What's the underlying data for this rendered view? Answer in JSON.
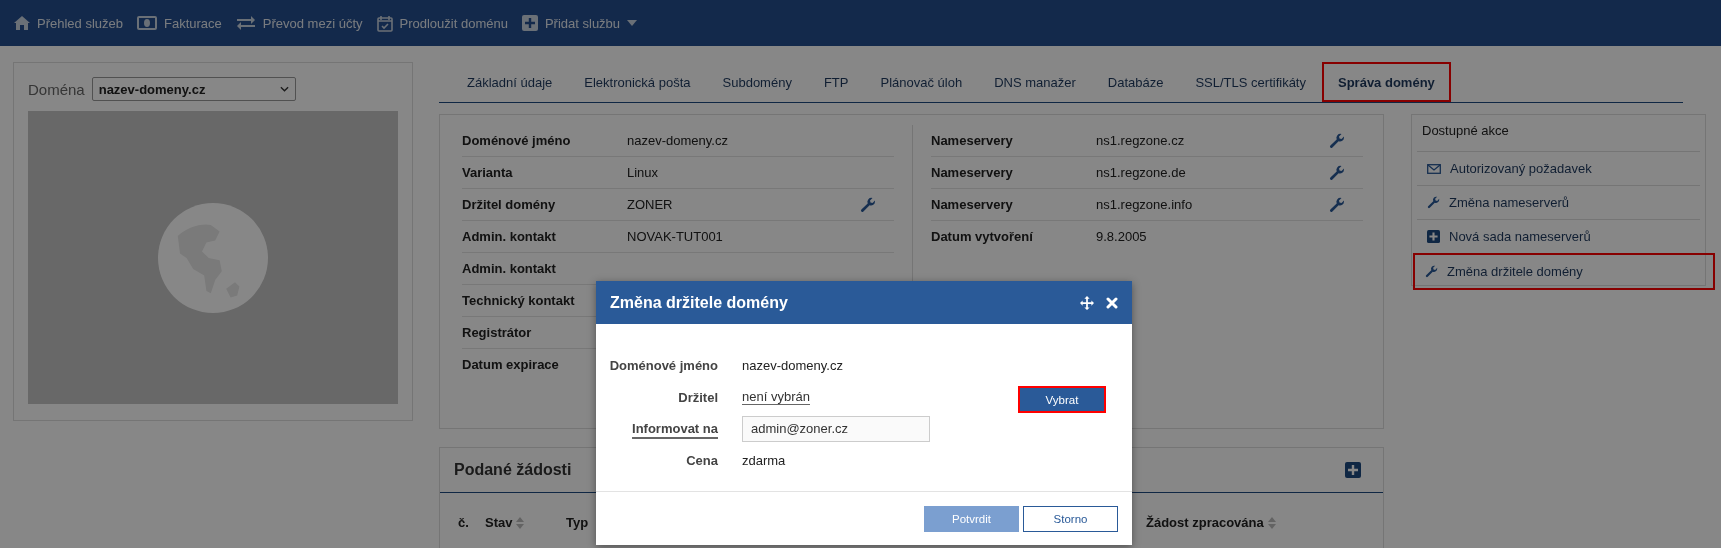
{
  "nav": [
    {
      "label": "Přehled služeb",
      "has_menu": false
    },
    {
      "label": "Fakturace",
      "has_menu": false
    },
    {
      "label": "Převod mezi účty",
      "has_menu": false
    },
    {
      "label": "Prodloužit doménu",
      "has_menu": false
    },
    {
      "label": "Přidat službu",
      "has_menu": true
    }
  ],
  "domain_picker": {
    "label": "Doména",
    "value": "nazev-domeny.cz"
  },
  "tabs": [
    {
      "label": "Základní údaje",
      "selected": false,
      "highlighted": false
    },
    {
      "label": "Elektronická pošta",
      "selected": false,
      "highlighted": false
    },
    {
      "label": "Subdomény",
      "selected": false,
      "highlighted": false
    },
    {
      "label": "FTP",
      "selected": false,
      "highlighted": false
    },
    {
      "label": "Plánovač úloh",
      "selected": false,
      "highlighted": false
    },
    {
      "label": "DNS manažer",
      "selected": false,
      "highlighted": false
    },
    {
      "label": "Databáze",
      "selected": false,
      "highlighted": false
    },
    {
      "label": "SSL/TLS certifikáty",
      "selected": false,
      "highlighted": false
    },
    {
      "label": "Správa domény",
      "selected": true,
      "highlighted": true
    }
  ],
  "details_left": [
    {
      "label": "Doménové jméno",
      "value": "nazev-domeny.cz",
      "editable": false
    },
    {
      "label": "Varianta",
      "value": "Linux",
      "editable": false
    },
    {
      "label": "Držitel domény",
      "value": "ZONER",
      "editable": true
    },
    {
      "label": "Admin. kontakt",
      "value": "NOVAK-TUT001",
      "editable": false
    },
    {
      "label": "Admin. kontakt",
      "editable": false
    },
    {
      "label": "Technický kontakt"
    },
    {
      "label": "Registrátor"
    },
    {
      "label": "Datum expirace"
    }
  ],
  "details_right": [
    {
      "label": "Nameservery",
      "value": "ns1.regzone.cz",
      "editable": true
    },
    {
      "label": "Nameservery",
      "value": "ns1.regzone.de",
      "editable": true
    },
    {
      "label": "Nameservery",
      "value": "ns1.regzone.info",
      "editable": true
    },
    {
      "label": "Datum vytvoření",
      "value": "9.8.2005",
      "editable": false
    }
  ],
  "actions": {
    "title": "Dostupné akce",
    "items": [
      {
        "label": "Autorizovaný požadavek",
        "kind": "mail",
        "highlighted": false
      },
      {
        "label": "Změna nameserverů",
        "kind": "wrench",
        "highlighted": false
      },
      {
        "label": "Nová sada nameserverů",
        "kind": "add",
        "highlighted": false
      },
      {
        "label": "Změna držitele domény",
        "kind": "wrench",
        "highlighted": true
      }
    ]
  },
  "requests": {
    "title": "Podané žádosti",
    "columns": [
      {
        "label": "č.",
        "sortable": false
      },
      {
        "label": "Stav",
        "sortable": true
      },
      {
        "label": "Typ",
        "sortable": false
      },
      {
        "label": "Žádost zpracována",
        "sortable": true
      }
    ]
  },
  "modal": {
    "title": "Změna držitele domény",
    "fields": [
      {
        "label": "Doménové jméno",
        "value": "nazev-domeny.cz",
        "kind": "text"
      },
      {
        "label": "Držitel",
        "value": "není vybrán",
        "kind": "link"
      },
      {
        "label": "Informovat na",
        "value": "admin@zoner.cz",
        "kind": "input"
      },
      {
        "label": "Cena",
        "value": "zdarma",
        "kind": "text"
      }
    ],
    "select_button": {
      "label": "Vybrat",
      "highlighted": true
    },
    "buttons": [
      {
        "label": "Potvrdit",
        "kind": "primary",
        "disabled": true
      },
      {
        "label": "Storno",
        "kind": "secondary",
        "disabled": false
      }
    ]
  }
}
